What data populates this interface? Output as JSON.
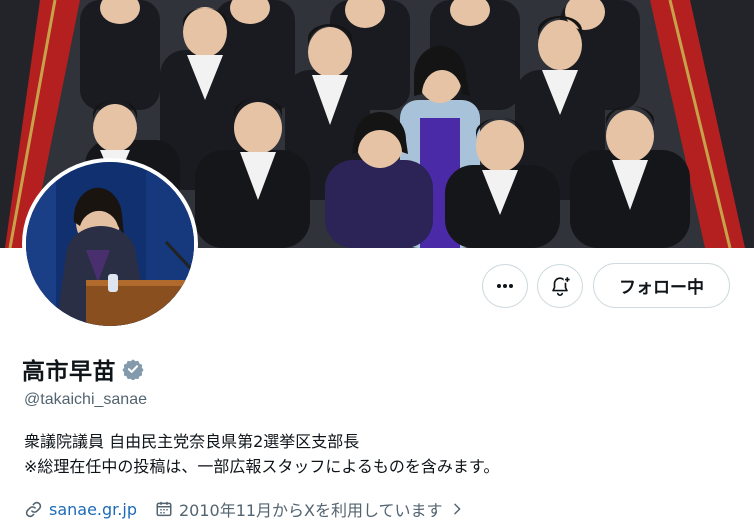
{
  "profile": {
    "display_name": "高市早苗",
    "handle": "@takaichi_sanae",
    "verified_icon": "verified-badge-icon",
    "bio_lines": [
      "衆議院議員 自由民主党奈良県第2選挙区支部長",
      "※総理在任中の投稿は、一部広報スタッフによるものを含みます。"
    ],
    "website": "sanae.gr.jp",
    "joined": "2010年11月からXを利用しています"
  },
  "actions": {
    "more_icon": "more-icon",
    "notify_icon": "notification-add-icon",
    "follow_label": "フォロー中"
  },
  "colors": {
    "verified": "#829aab",
    "link": "#1d6bb8",
    "muted": "#536471"
  }
}
